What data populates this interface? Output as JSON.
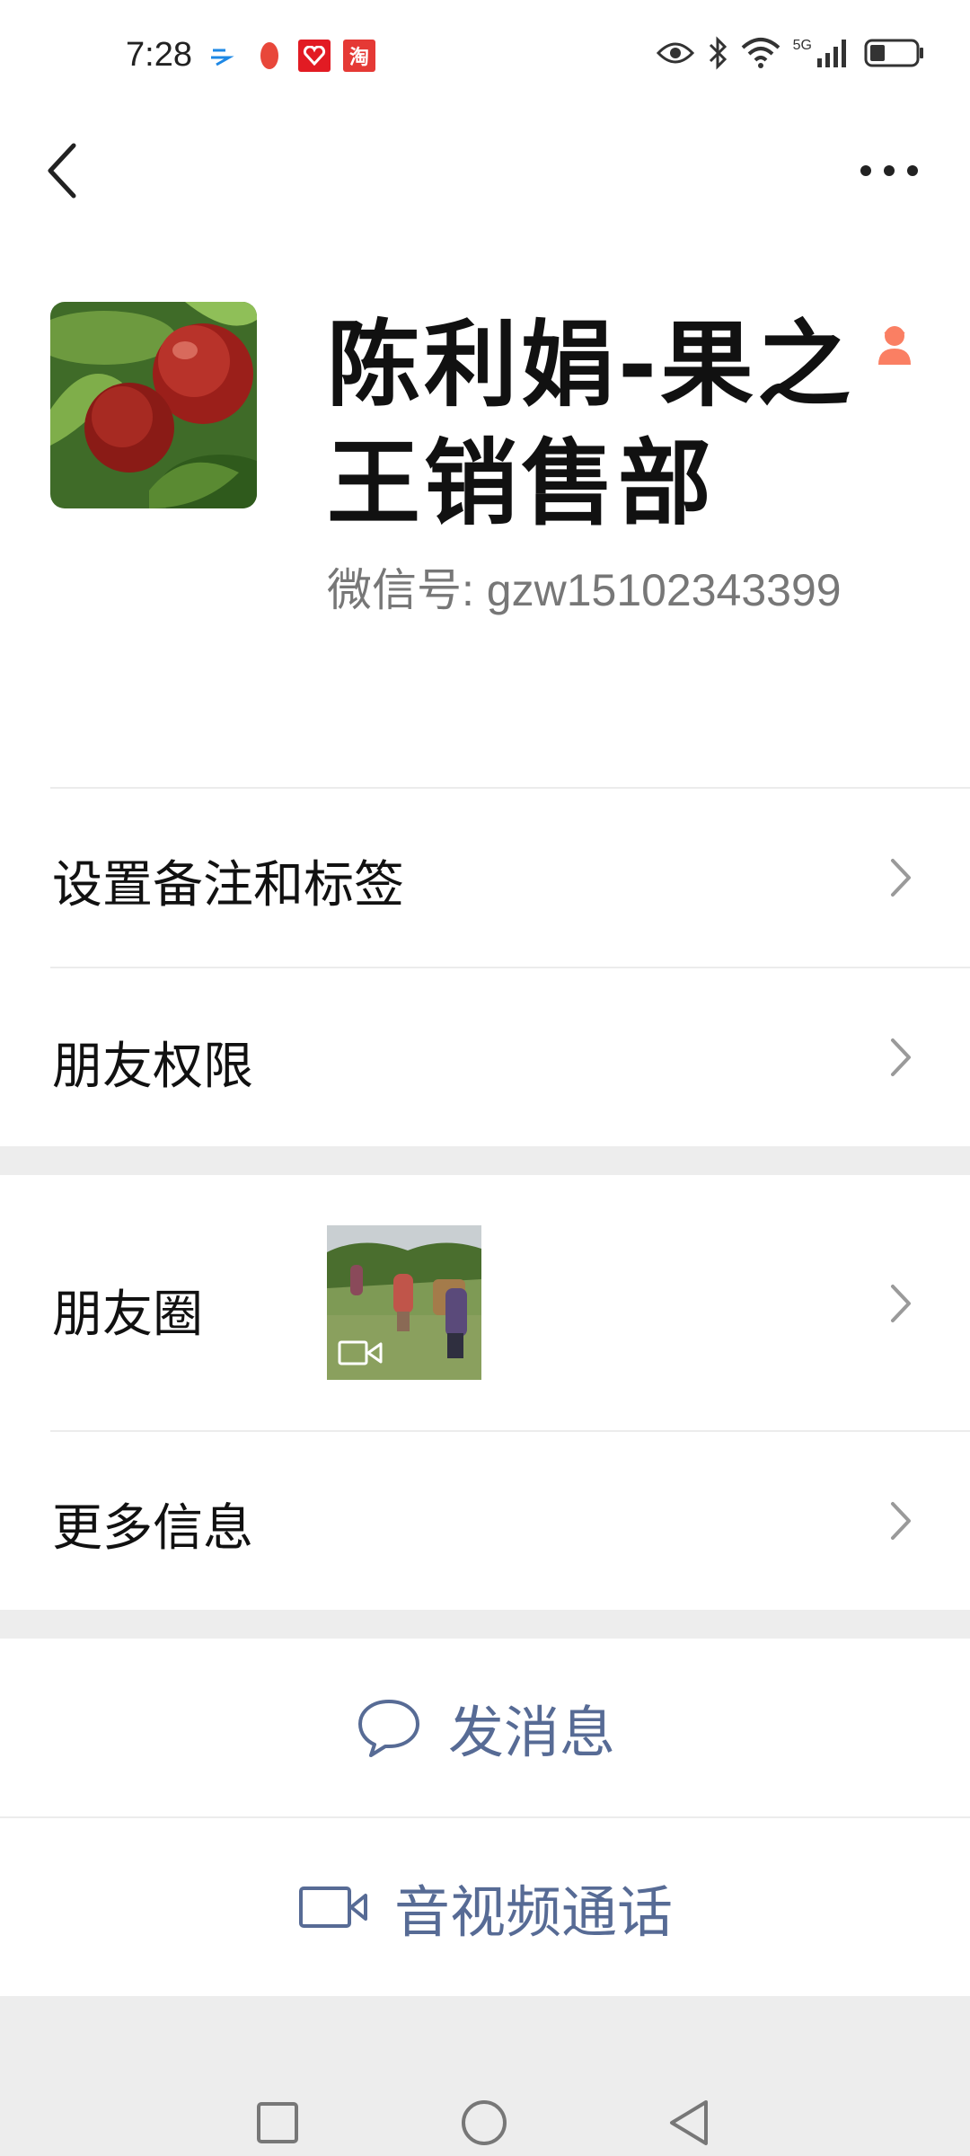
{
  "status_bar": {
    "time": "7:28",
    "notification_icons": [
      "cloud-app-icon",
      "peach-app-icon",
      "red-app-icon",
      "taobao-icon"
    ],
    "taobao_glyph": "淘",
    "network_label": "5G"
  },
  "header": {
    "back_icon": "chevron-left-icon",
    "more_icon": "more-dots-icon"
  },
  "profile": {
    "name": "陈利娟-果之王销售部",
    "wechat_id": "微信号: gzw15102343399",
    "gender_icon": "female-person-icon"
  },
  "menu": {
    "remark_tags": "设置备注和标签",
    "friend_permissions": "朋友权限",
    "moments": "朋友圈",
    "more_info": "更多信息"
  },
  "actions": {
    "send_message": "发消息",
    "av_call": "音视频通话"
  },
  "colors": {
    "link_blue": "#576b95",
    "divider_gray": "#ececec",
    "band_gray": "#ededed",
    "gender_accent": "#fa7f63"
  }
}
